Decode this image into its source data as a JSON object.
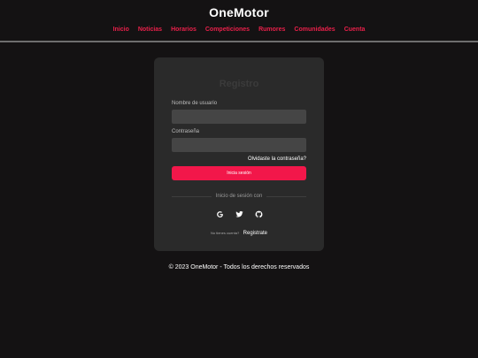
{
  "header": {
    "title": "OneMotor",
    "nav": [
      "Inicio",
      "Noticias",
      "Horarios",
      "Competiciones",
      "Rumores",
      "Comunidades",
      "Cuenta"
    ]
  },
  "form": {
    "title": "Registro",
    "username_label": "Nombre de usuario",
    "password_label": "Contraseña",
    "forgot_link": "Olvidaste la contraseña?",
    "login_button": "Inicia sesión",
    "divider_text": "Inicio de sesión con",
    "social_icons": [
      "google-icon",
      "twitter-icon",
      "github-icon"
    ],
    "signup_question": "No tienes cuenta?",
    "signup_link": "Registrate"
  },
  "footer": {
    "text": "© 2023 OneMotor - Todos los derechos reservados"
  },
  "colors": {
    "background": "#141213",
    "card": "#2a2a2a",
    "accent": "#f2174a",
    "nav_link": "#e8204a"
  }
}
